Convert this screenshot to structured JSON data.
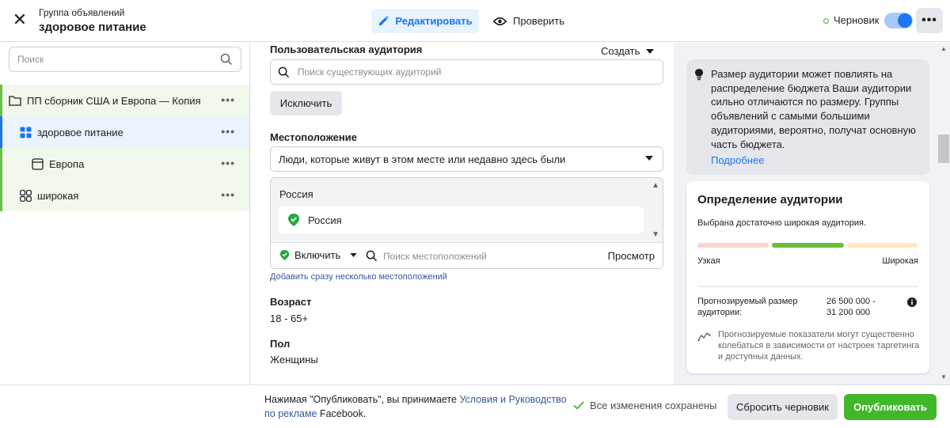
{
  "header": {
    "close_glyph": "✕",
    "group_subtitle": "Группа объявлений",
    "group_title": "здоровое питание",
    "edit_label": "Редактировать",
    "check_label": "Проверить",
    "status_label": "Черновик",
    "more_glyph": "•••",
    "toggle_on": true
  },
  "sidebar": {
    "search_placeholder": "Поиск",
    "items": [
      {
        "label": "ПП сборник США и Европа — Копия",
        "icon": "folder-icon",
        "level": "campaign"
      },
      {
        "label": "здоровое питание",
        "icon": "adset-grid-icon",
        "level": "adset",
        "selected": true
      },
      {
        "label": "Европа",
        "icon": "ad-icon",
        "level": "ad"
      },
      {
        "label": "широкая",
        "icon": "adset-grid-icon",
        "level": "adset"
      }
    ],
    "dots": "•••"
  },
  "main": {
    "custom_audience_label": "Пользовательская аудитория",
    "create_label": "Создать",
    "audience_search_placeholder": "Поиск существующих аудиторий",
    "exclude_label": "Исключить",
    "location_label": "Местоположение",
    "location_select_value": "Люди, которые живут в этом месте или недавно здесь были",
    "location_group": "Россия",
    "location_chip": "Россия",
    "include_label": "Включить",
    "location_search_placeholder": "Поиск местоположений",
    "browse_label": "Просмотр",
    "multi_location_link": "Добавить сразу несколько местоположений",
    "age_label": "Возраст",
    "age_value": "18 - 65+",
    "gender_label": "Пол",
    "gender_value": "Женщины"
  },
  "right": {
    "tip_text": "Размер аудитории может повлиять на распределение бюджета Ваши аудитории сильно отличаются по размеру. Группы объявлений с самыми большими аудиториями, вероятно, получат основную часть бюджета.",
    "tip_link": "Подробнее",
    "definition_title": "Определение аудитории",
    "definition_sub": "Выбрана достаточно широкая аудитория.",
    "meter_level": "middle",
    "narrow_label": "Узкая",
    "wide_label": "Широкая",
    "estimate_label": "Прогнозируемый размер аудитории:",
    "estimate_value": "26 500 000 - 31 200 000",
    "note": "Прогнозируемые показатели могут существенно колебаться в зависимости от настроек таргетинга и доступных данных."
  },
  "footer": {
    "legal_prefix": "Нажимая \"Опубликовать\", вы принимаете ",
    "legal_link": "Условия и Руководство по рекламе",
    "legal_suffix": " Facebook.",
    "saved_label": "Все изменения сохранены",
    "reset_label": "Сбросить черновик",
    "publish_label": "Опубликовать"
  },
  "colors": {
    "accent": "#1877f2",
    "publish": "#42b72a",
    "link": "#385898"
  }
}
